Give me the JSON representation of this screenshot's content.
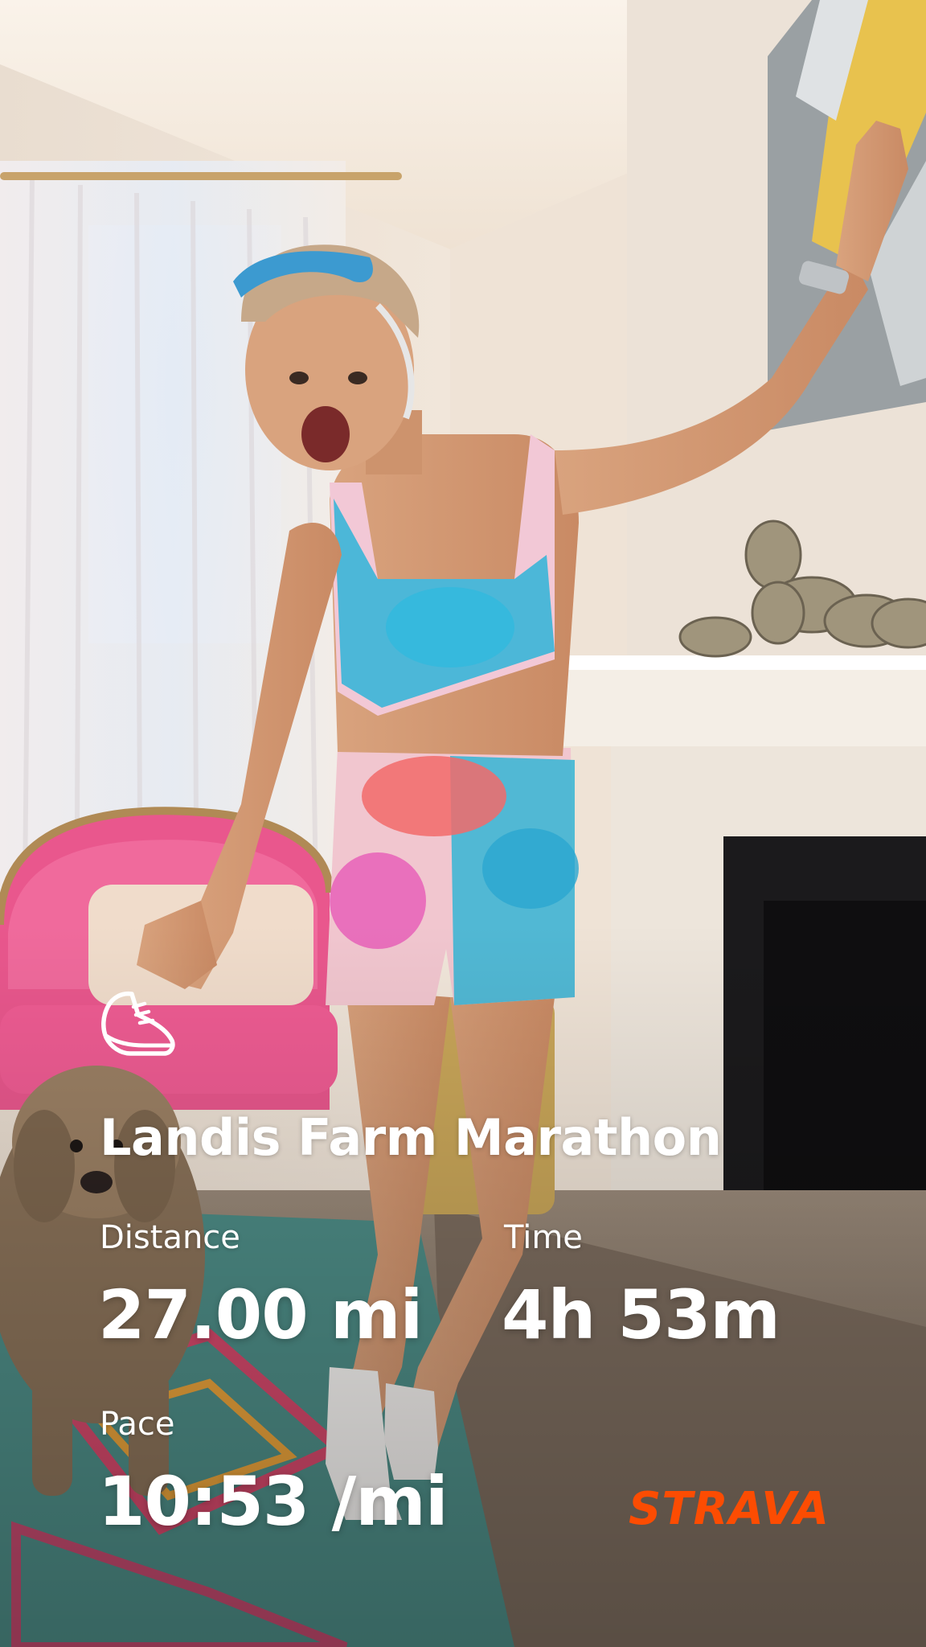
{
  "activity": {
    "icon": "running-shoe-icon",
    "title": "Landis Farm Marathon"
  },
  "stats": {
    "distance": {
      "label": "Distance",
      "value": "27.00 mi"
    },
    "time": {
      "label": "Time",
      "value": "4h 53m"
    },
    "pace": {
      "label": "Pace",
      "value": "10:53 /mi"
    }
  },
  "brand": {
    "name": "STRAVA",
    "color": "#FC4C02"
  },
  "photo": {
    "scene": "room-with-runner-dog-fireplace"
  },
  "colors": {
    "text": "#FFFFFF",
    "accent": "#FC4C02"
  }
}
